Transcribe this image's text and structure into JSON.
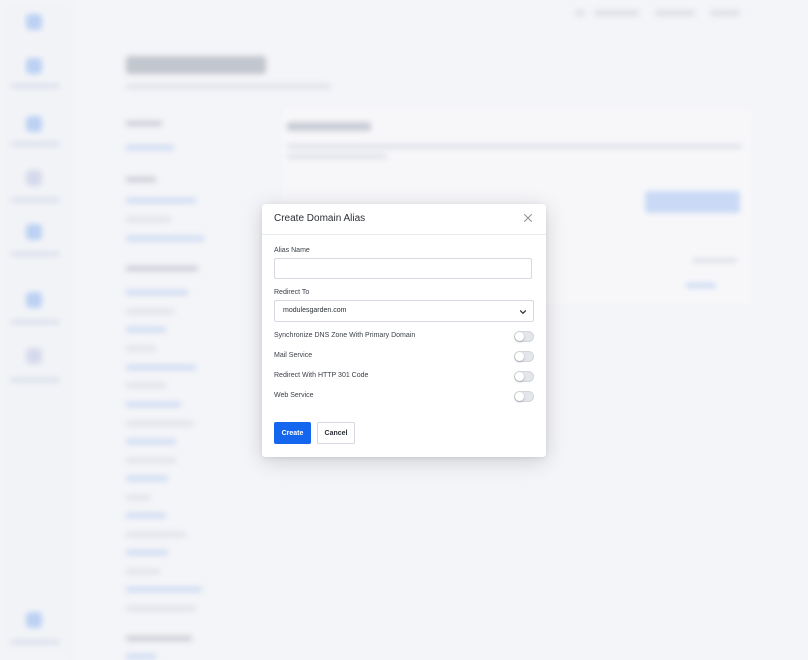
{
  "modal": {
    "title": "Create Domain Alias",
    "close_icon": "close-icon",
    "alias_name": {
      "label": "Alias Name",
      "value": "",
      "placeholder": ""
    },
    "redirect_to": {
      "label": "Redirect To",
      "selected": "modulesgarden.com",
      "icon": "chevron-down-icon"
    },
    "toggles": [
      {
        "label": "Synchronize DNS Zone With Primary Domain",
        "on": false
      },
      {
        "label": "Mail Service",
        "on": false
      },
      {
        "label": "Redirect With HTTP 301 Code",
        "on": false
      },
      {
        "label": "Web Service",
        "on": false
      }
    ],
    "buttons": {
      "create_label": "Create",
      "cancel_label": "Cancel"
    }
  },
  "colors": {
    "primary": "#1566ee",
    "toggle_off": "#e3e6ea",
    "backdrop": "#f6f7f9"
  }
}
